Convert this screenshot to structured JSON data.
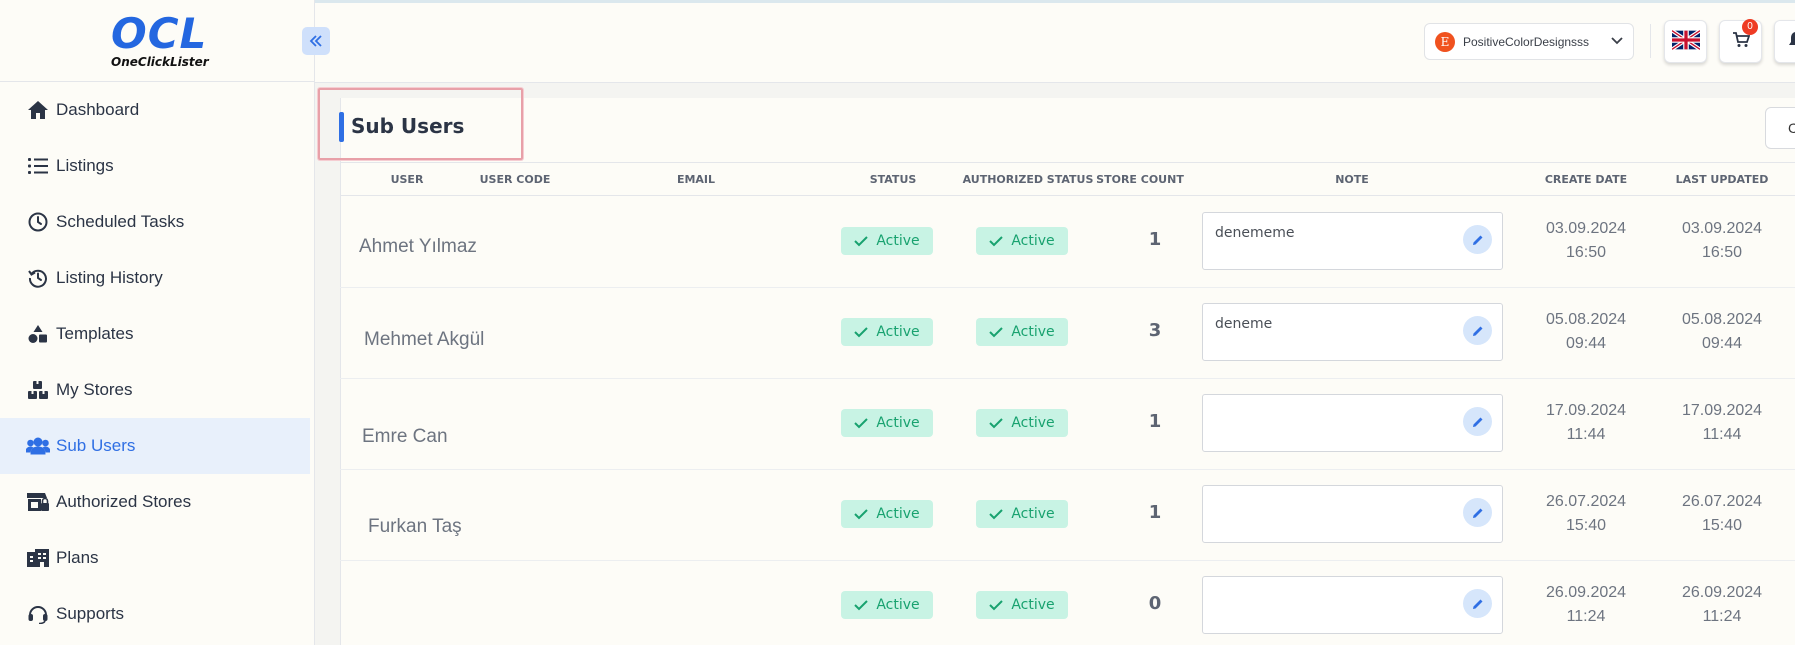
{
  "app": {
    "logo_text": "OCL",
    "logo_subtitle": "OneClickLister",
    "collapse_icon": "«"
  },
  "sidebar": {
    "items": [
      {
        "label": "Dashboard",
        "icon": "home-icon"
      },
      {
        "label": "Listings",
        "icon": "list-icon"
      },
      {
        "label": "Scheduled Tasks",
        "icon": "clock-icon"
      },
      {
        "label": "Listing History",
        "icon": "history-icon"
      },
      {
        "label": "Templates",
        "icon": "shapes-icon"
      },
      {
        "label": "My Stores",
        "icon": "boxes-icon"
      },
      {
        "label": "Sub Users",
        "icon": "users-icon",
        "active": true
      },
      {
        "label": "Authorized Stores",
        "icon": "store-lock-icon"
      },
      {
        "label": "Plans",
        "icon": "plans-icon"
      },
      {
        "label": "Supports",
        "icon": "headset-icon"
      }
    ]
  },
  "header": {
    "store_badge": "E",
    "store_name": "PositiveColorDesignsss",
    "cart_count": "0",
    "language_icon": "uk-flag-icon"
  },
  "page": {
    "title": "Sub Users",
    "right_button_label": "C"
  },
  "table": {
    "columns": {
      "user": "USER",
      "user_code": "USER CODE",
      "email": "EMAIL",
      "status": "STATUS",
      "authorized_status": "AUTHORIZED STATUS",
      "store_count": "STORE COUNT",
      "note": "NOTE",
      "create_date": "CREATE DATE",
      "last_updated": "LAST UPDATED"
    },
    "rows": [
      {
        "user": "Ahmet Yılmaz",
        "status": "Active",
        "authorized_status": "Active",
        "store_count": "1",
        "note": "denememe",
        "create_date": "03.09.2024",
        "create_time": "16:50",
        "updated_date": "03.09.2024",
        "updated_time": "16:50"
      },
      {
        "user": "Mehmet Akgül",
        "status": "Active",
        "authorized_status": "Active",
        "store_count": "3",
        "note": "deneme",
        "create_date": "05.08.2024",
        "create_time": "09:44",
        "updated_date": "05.08.2024",
        "updated_time": "09:44"
      },
      {
        "user": "Emre Can",
        "status": "Active",
        "authorized_status": "Active",
        "store_count": "1",
        "note": "",
        "create_date": "17.09.2024",
        "create_time": "11:44",
        "updated_date": "17.09.2024",
        "updated_time": "11:44"
      },
      {
        "user": "Furkan Taş",
        "status": "Active",
        "authorized_status": "Active",
        "store_count": "1",
        "note": "",
        "create_date": "26.07.2024",
        "create_time": "15:40",
        "updated_date": "26.07.2024",
        "updated_time": "15:40"
      },
      {
        "user": "",
        "status": "Active",
        "authorized_status": "Active",
        "store_count": "0",
        "note": "",
        "create_date": "26.09.2024",
        "create_time": "11:24",
        "updated_date": "26.09.2024",
        "updated_time": "11:24"
      }
    ]
  },
  "colors": {
    "accent": "#2f6fe4",
    "active_badge_bg": "#c8f3e4",
    "active_badge_text": "#18a26f",
    "cart_badge": "#ee3b24",
    "store_badge": "#f0521f"
  }
}
